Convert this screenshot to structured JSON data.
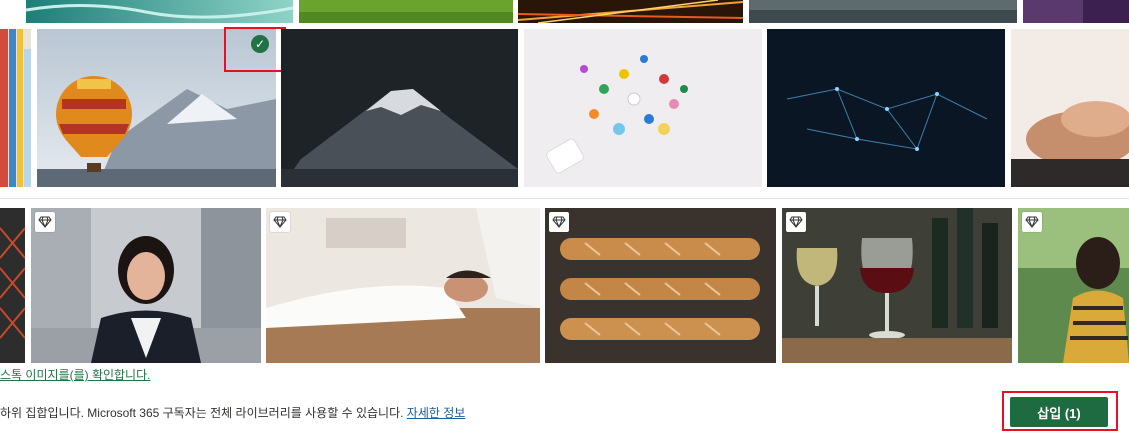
{
  "gallery": {
    "row0": [
      {
        "name": "pool-water-image"
      },
      {
        "name": "green-grass-image"
      },
      {
        "name": "light-trails-image"
      },
      {
        "name": "dark-water-image"
      },
      {
        "name": "purple-image"
      }
    ],
    "row1": [
      {
        "name": "books-image"
      },
      {
        "name": "hot-air-balloon-image",
        "selected": true
      },
      {
        "name": "mountain-peak-image"
      },
      {
        "name": "pills-image"
      },
      {
        "name": "network-mesh-image"
      },
      {
        "name": "holding-hands-image"
      }
    ],
    "row2": [
      {
        "name": "building-scaffold-image"
      },
      {
        "name": "business-woman-image",
        "premium": true
      },
      {
        "name": "massage-image",
        "premium": true
      },
      {
        "name": "baguettes-image",
        "premium": true
      },
      {
        "name": "wine-glasses-image",
        "premium": true
      },
      {
        "name": "woman-outdoors-image",
        "premium": true
      }
    ],
    "selected_icon": "checkmark-icon",
    "premium_icon": "diamond-icon",
    "accent_color": "#217346"
  },
  "stock_link": "스톡 이미지를(를) 확인합니다.",
  "footer": {
    "note": "하위 집합입니다. Microsoft 365 구독자는 전체 라이브러리를 사용할 수 있습니다.",
    "learn_more": "자세한 정보"
  },
  "insert_button": {
    "label": "삽입 (1)",
    "color": "#1e6b41"
  }
}
